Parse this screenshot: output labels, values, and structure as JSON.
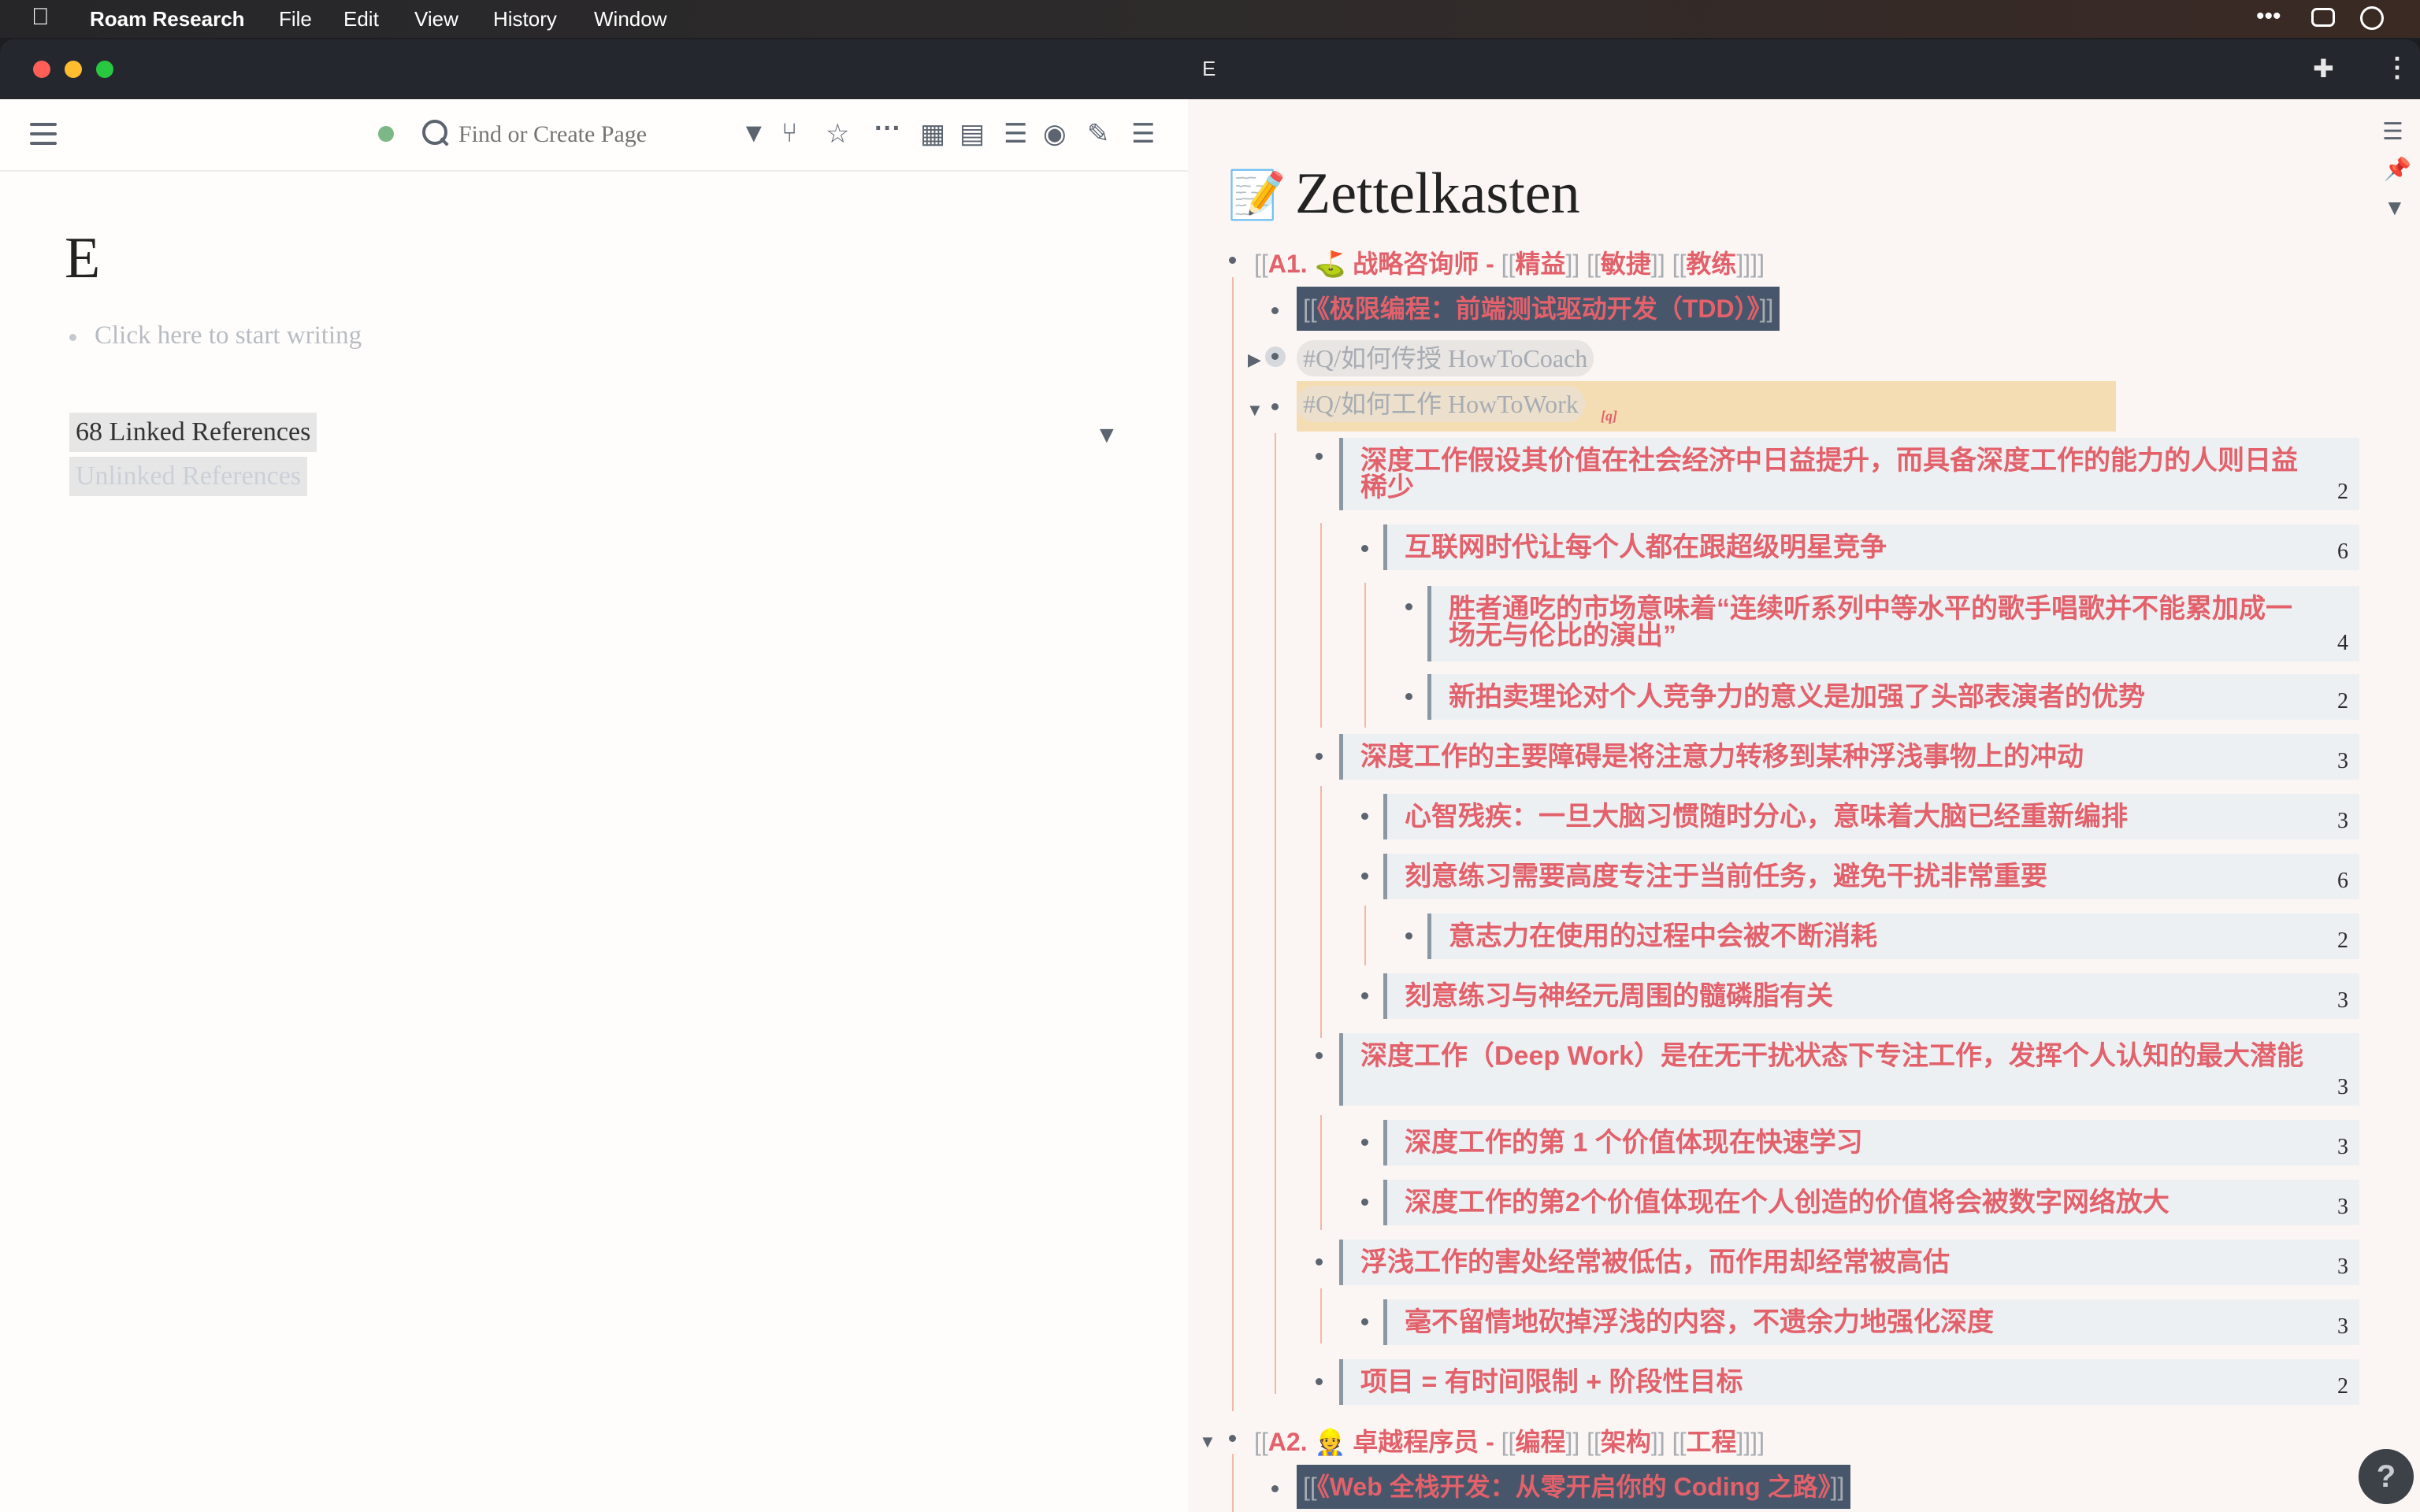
{
  "menubar": {
    "app_name": "Roam Research",
    "items": [
      "File",
      "Edit",
      "View",
      "History",
      "Window"
    ]
  },
  "window": {
    "title": "E"
  },
  "search": {
    "placeholder": "Find or Create Page"
  },
  "left_page": {
    "title": "E",
    "placeholder": "Click here to start writing",
    "linked_refs": "68 Linked References",
    "unlinked_refs": "Unlinked References"
  },
  "right_page": {
    "emoji": "📝",
    "title": "Zettelkasten",
    "a1": {
      "open": "[[",
      "label": "A1. ⛳ 战略咨询师",
      "sep": " - ",
      "tags": [
        "精益",
        "敏捷",
        "教练"
      ],
      "close": "]]"
    },
    "a1_book": {
      "open": "[[",
      "label": "《极限编程：前端测试驱动开发（TDD）》",
      "close": "]]"
    },
    "q_coach": "#Q/如何传授 HowToCoach",
    "q_work": "#Q/如何工作 HowToWork",
    "q_work_marker": "[q]",
    "rows": [
      {
        "text": "深度工作假设其价值在社会经济中日益提升，而具备深度工作的能力的人则日益",
        "text2": "稀少",
        "count": "2"
      },
      {
        "text": "互联网时代让每个人都在跟超级明星竞争",
        "count": "6"
      },
      {
        "text": "胜者通吃的市场意味着“连续听系列中等水平的歌手唱歌并不能累加成一",
        "text2": "场无与伦比的演出”",
        "count": "4"
      },
      {
        "text": "新拍卖理论对个人竞争力的意义是加强了头部表演者的优势",
        "count": "2"
      },
      {
        "text": "深度工作的主要障碍是将注意力转移到某种浮浅事物上的冲动",
        "count": "3"
      },
      {
        "text": "心智残疾：一旦大脑习惯随时分心，意味着大脑已经重新编排",
        "count": "3"
      },
      {
        "text": "刻意练习需要高度专注于当前任务，避免干扰非常重要",
        "count": "6"
      },
      {
        "text": "意志力在使用的过程中会被不断消耗",
        "count": "2"
      },
      {
        "text": "刻意练习与神经元周围的髓磷脂有关",
        "count": "3"
      },
      {
        "text": "深度工作（Deep Work）是在无干扰状态下专注工作，发挥个人认知的最大潜能",
        "count": "3"
      },
      {
        "text": "深度工作的第 1 个价值体现在快速学习",
        "count": "3"
      },
      {
        "text": "深度工作的第2个价值体现在个人创造的价值将会被数字网络放大",
        "count": "3"
      },
      {
        "text": "浮浅工作的害处经常被低估，而作用却经常被高估",
        "count": "3"
      },
      {
        "text": "毫不留情地砍掉浮浅的内容，不遗余力地强化深度",
        "count": "3"
      },
      {
        "text": "项目 = 有时间限制 + 阶段性目标",
        "count": "2"
      }
    ],
    "a2": {
      "open": "[[",
      "label": "A2. 👷 卓越程序员",
      "sep": " - ",
      "tags": [
        "编程",
        "架构",
        "工程"
      ],
      "close": "]]"
    },
    "a2_book": {
      "open": "[[",
      "label": "《Web 全栈开发：从零开启你的 Coding 之路》",
      "close": "]]"
    }
  },
  "help": "?"
}
